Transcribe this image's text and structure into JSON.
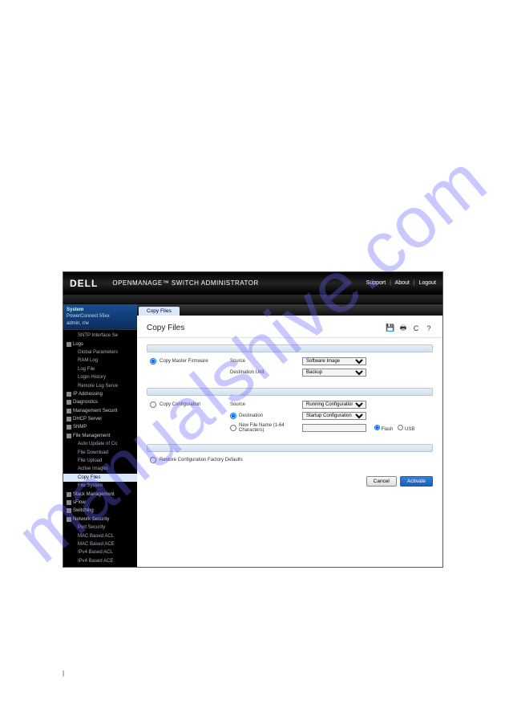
{
  "watermark": "manualshive.com",
  "header": {
    "logo": "DELL",
    "title": "OPENMANAGE™ SWITCH ADMINISTRATOR",
    "links": {
      "support": "Support",
      "about": "About",
      "logout": "Logout"
    }
  },
  "sidebar": {
    "system_label": "System",
    "device": "PowerConnect 55xx",
    "user": "admin, r/w",
    "tree": [
      {
        "label": "SNTP Interface Se",
        "level": 2
      },
      {
        "label": "Logs",
        "level": 1,
        "toggle": true
      },
      {
        "label": "Global Parameters",
        "level": 2
      },
      {
        "label": "RAM Log",
        "level": 2
      },
      {
        "label": "Log File",
        "level": 2
      },
      {
        "label": "Login History",
        "level": 2
      },
      {
        "label": "Remote Log Serve",
        "level": 2
      },
      {
        "label": "IP Addressing",
        "level": 1,
        "toggle": true
      },
      {
        "label": "Diagnostics",
        "level": 1,
        "toggle": true
      },
      {
        "label": "Management Securit",
        "level": 1,
        "toggle": true
      },
      {
        "label": "DHCP Server",
        "level": 1,
        "toggle": true
      },
      {
        "label": "SNMP",
        "level": 1,
        "toggle": true
      },
      {
        "label": "File Management",
        "level": 1,
        "toggle": true
      },
      {
        "label": "Auto Update of Co",
        "level": 2
      },
      {
        "label": "File Download",
        "level": 2
      },
      {
        "label": "File Upload",
        "level": 2
      },
      {
        "label": "Active Images",
        "level": 2
      },
      {
        "label": "Copy Files",
        "level": 2,
        "active": true
      },
      {
        "label": "File System",
        "level": 2
      },
      {
        "label": "Stack Management",
        "level": 1,
        "toggle": true
      },
      {
        "label": "sFlow",
        "level": 1,
        "toggle": true
      },
      {
        "label": "Switching",
        "level": 0,
        "toggle": true
      },
      {
        "label": "Network Security",
        "level": 1,
        "toggle": true
      },
      {
        "label": "Port Security",
        "level": 2
      },
      {
        "label": "MAC Based ACL",
        "level": 2
      },
      {
        "label": "MAC Based ACE",
        "level": 2
      },
      {
        "label": "IPv4 Based ACL",
        "level": 2
      },
      {
        "label": "IPv4 Based ACE",
        "level": 2
      }
    ]
  },
  "content": {
    "tab": "Copy Files",
    "title": "Copy Files",
    "icons": {
      "save": "💾",
      "print": "🖶",
      "refresh": "C",
      "help": "?"
    },
    "section1": {
      "radio_label": "Copy Master Firmware",
      "source_label": "Source",
      "source_value": "Software Image",
      "dest_label": "Destination Unit",
      "dest_value": "Backup"
    },
    "section2": {
      "radio_label": "Copy Configuration",
      "source_label": "Source",
      "source_value": "Running Configuration",
      "dest_radio_label": "Destination",
      "dest_value": "Startup Configuration",
      "new_file_label": "New File Name (1-64 Characters)",
      "flash_label": "Flash",
      "usb_label": "USB"
    },
    "section3": {
      "radio_label": "Restore Configuration Factory Defaults"
    },
    "buttons": {
      "cancel": "Cancel",
      "activate": "Activate"
    }
  },
  "footer_mark": "|"
}
